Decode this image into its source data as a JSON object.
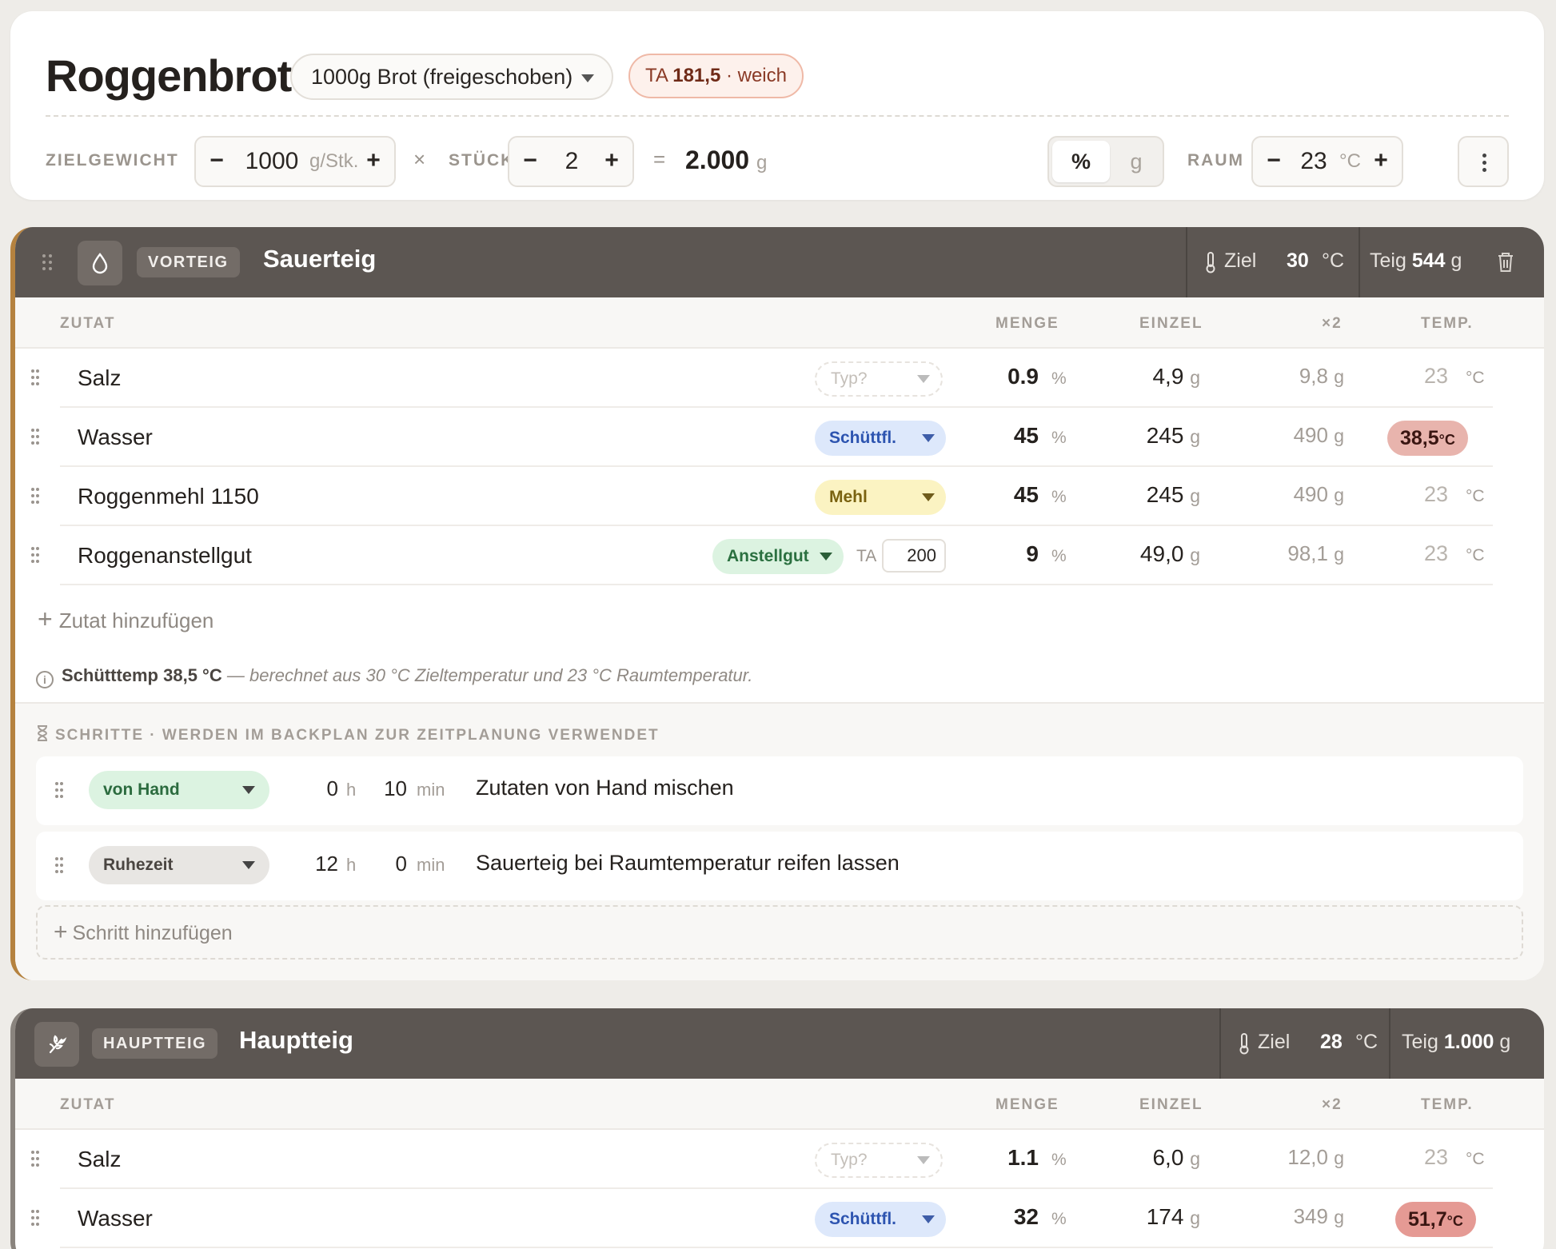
{
  "header": {
    "title": "Roggenbrot",
    "preset": "1000g Brot (freigeschoben)",
    "ta_prefix": "TA",
    "ta_value": "181,5",
    "ta_suffix": "· weich",
    "zielgewicht_label": "ZIELGEWICHT",
    "zielgewicht_value": "1000",
    "zielgewicht_unit": "g/Stk.",
    "times_symbol": "×",
    "stueck_label": "STÜCK",
    "stueck_value": "2",
    "equals_symbol": "=",
    "total_value": "2.000",
    "total_unit": "g",
    "toggle_percent": "%",
    "toggle_gram": "g",
    "raum_label": "RAUM",
    "raum_value": "23",
    "raum_unit": "°C",
    "minus": "−",
    "plus": "+"
  },
  "columns": {
    "zutat": "ZUTAT",
    "menge": "MENGE",
    "einzel": "EINZEL",
    "x2": "×2",
    "temp": "TEMP."
  },
  "sections": [
    {
      "badge": "VORTEIG",
      "title": "Sauerteig",
      "ziel_label": "Ziel",
      "ziel_value": "30",
      "ziel_unit": "°C",
      "teig_label": "Teig",
      "teig_value": "544",
      "teig_unit": "g",
      "accent_color": "#b5823f",
      "ingredients": [
        {
          "name": "Salz",
          "type": "Typ?",
          "menge": "0.9",
          "pct": "%",
          "einzel": "4,9",
          "x2": "9,8",
          "temp": "23",
          "temp_unit": "°C"
        },
        {
          "name": "Wasser",
          "type": "Schüttfl.",
          "menge": "45",
          "pct": "%",
          "einzel": "245",
          "x2": "490",
          "temp": "38,5",
          "temp_unit": "°C",
          "temp_color": "#e8b4ad"
        },
        {
          "name": "Roggenmehl 1150",
          "type": "Mehl",
          "menge": "45",
          "pct": "%",
          "einzel": "245",
          "x2": "490",
          "temp": "23",
          "temp_unit": "°C"
        },
        {
          "name": "Roggenanstellgut",
          "type": "Anstellgut",
          "ta_label": "TA",
          "ta_value": "200",
          "menge": "9",
          "pct": "%",
          "einzel": "49,0",
          "x2": "98,1",
          "temp": "23",
          "temp_unit": "°C"
        }
      ],
      "unit_g": "g",
      "add_ingredient": "Zutat hinzufügen",
      "note_bold": "Schütttemp 38,5 °C",
      "note_text": "— berechnet aus 30 °C Zieltemperatur und 23 °C Raumtemperatur.",
      "steps_header": "SCHRITTE · WERDEN IM BACKPLAN ZUR ZEITPLANUNG VERWENDET",
      "steps": [
        {
          "type": "von Hand",
          "hours": "0",
          "h": "h",
          "minutes": "10",
          "min": "min",
          "desc": "Zutaten von Hand mischen"
        },
        {
          "type": "Ruhezeit",
          "hours": "12",
          "h": "h",
          "minutes": "0",
          "min": "min",
          "desc": "Sauerteig bei Raumtemperatur reifen lassen"
        }
      ],
      "add_step": "Schritt hinzufügen"
    },
    {
      "badge": "HAUPTTEIG",
      "title": "Hauptteig",
      "ziel_label": "Ziel",
      "ziel_value": "28",
      "ziel_unit": "°C",
      "teig_label": "Teig",
      "teig_value": "1.000",
      "teig_unit": "g",
      "accent_color": "#8a847e",
      "ingredients": [
        {
          "name": "Salz",
          "type": "Typ?",
          "menge": "1.1",
          "pct": "%",
          "einzel": "6,0",
          "x2": "12,0",
          "temp": "23",
          "temp_unit": "°C"
        },
        {
          "name": "Wasser",
          "type": "Schüttfl.",
          "menge": "32",
          "pct": "%",
          "einzel": "174",
          "x2": "349",
          "temp": "51,7",
          "temp_unit": "°C",
          "temp_color": "#e59a94"
        }
      ],
      "unit_g": "g"
    }
  ]
}
